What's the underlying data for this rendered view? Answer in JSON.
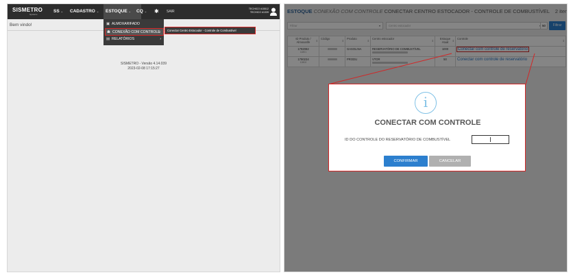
{
  "left": {
    "logo": "SISMETRO",
    "logo_sub": "Systems",
    "nav": [
      {
        "label": "SS",
        "caret": "⌄"
      },
      {
        "label": "CADASTRO",
        "caret": "⌄"
      },
      {
        "label": "ESTOQUE",
        "caret": "⌄"
      },
      {
        "label": "CQ",
        "caret": "⌄"
      }
    ],
    "sair": "SAIR",
    "user_line1": "TECHICO #15512",
    "user_line2": "TECHICO #1339",
    "welcome": "Bem vindo!",
    "dropdown": [
      {
        "label": "ALMOXARIFADO",
        "icon": "▣"
      },
      {
        "label": "CONEXÃO COM CONTROLE",
        "icon": "☗"
      },
      {
        "label": "RELATÓRIOS",
        "icon": "▤"
      }
    ],
    "submenu": "Conectar Centro Estocador - Controle de Combustível",
    "version_line1": "SISMETRO - Versão 4.14.039",
    "version_line2": "2023-02-08 17:15:27"
  },
  "right": {
    "title_bold": "ESTOQUE",
    "title_italic": "CONEXÃO COM CONTROLE",
    "title_rest": "CONECTAR CENTRO ESTOCADOR - CONTROLE DE COMBUSTÍVEL",
    "title_count": "2 itens",
    "filter_placeholder": "Filtrar",
    "centro_placeholder": "Centro estocador",
    "page_size": "50",
    "filtrar_label": "Filtrar",
    "columns": [
      "ID Produto / Almoxarife",
      "Código",
      "Produto",
      "Centro estocador",
      "Estoque Atual",
      "Controle"
    ],
    "rows": [
      {
        "id": "1792082",
        "id_sub": "11801",
        "produto": "GASOLINA",
        "centro": "RESERVATÓRIO DE COMBUSTÍVEL",
        "estoque": "1000",
        "controle": "Conectar com controle de reservatório"
      },
      {
        "id": "1790234",
        "id_sub": "10802",
        "produto": "PRODU",
        "centro": "VTOR",
        "estoque": "50",
        "controle": "Conectar com controle de reservatório"
      }
    ],
    "modal": {
      "icon": "i",
      "title": "CONECTAR COM CONTROLE",
      "label": "ID DO CONTROLE DO RESERVATÓRIO DE COMBUSTÍVEL",
      "confirm": "CONFIRMAR",
      "cancel": "CANCELAR"
    }
  }
}
